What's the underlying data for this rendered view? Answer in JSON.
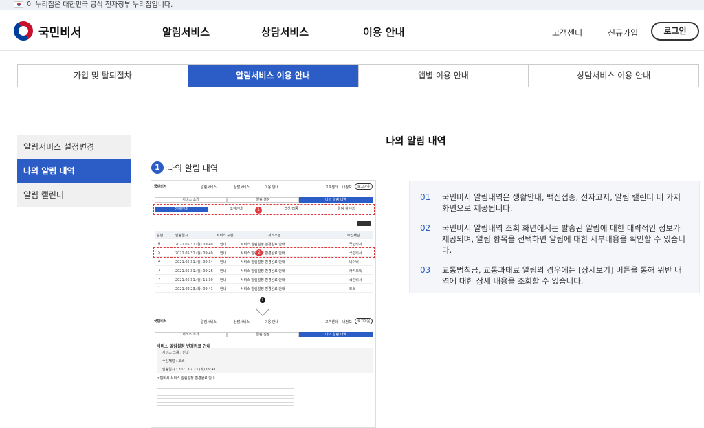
{
  "gov_banner": "이 누리집은 대한민국 공식 전자정부 누리집입니다.",
  "logo": "국민비서",
  "gnb": [
    "알림서비스",
    "상담서비스",
    "이용 안내"
  ],
  "util": {
    "help": "고객센터",
    "signup": "신규가입",
    "login": "로그인"
  },
  "tabs": [
    "가입 및 탈퇴절차",
    "알림서비스 이용 안내",
    "앱별 이용 안내",
    "상담서비스 이용 안내"
  ],
  "side": [
    "알림서비스 설정변경",
    "나의 알림 내역",
    "알림 캘린더"
  ],
  "page_title": "나의 알림 내역",
  "step": {
    "num": "1",
    "label": "나의 알림 내역"
  },
  "shot": {
    "logo": "국민비서",
    "gnb": [
      "알림서비스",
      "상담서비스",
      "이용 안내"
    ],
    "util": [
      "고객센터",
      "내정보",
      "로그아웃"
    ],
    "tabs": [
      "서비스 소개",
      "알림 설정",
      "나의 알림 내역"
    ],
    "subtabs": [
      "생활안내",
      "소식안내",
      "백신/접종",
      "알림 캘린더"
    ],
    "cols": [
      "순번",
      "발송일시",
      "서비스 구분",
      "서비스명",
      "수신채널"
    ],
    "rows": [
      [
        "6",
        "2021.05.31.(월) 09:40",
        "안내",
        "서비스 알림설정 변경완료 안내",
        "국민비서"
      ],
      [
        "5",
        "2021.05.31.(월) 09:40",
        "안내",
        "서비스 알림설정 변경완료 안내",
        "국민비서"
      ],
      [
        "4",
        "2021.05.31.(월) 09:34",
        "안내",
        "서비스 알림설정 변경완료 안내",
        "네이버"
      ],
      [
        "3",
        "2021.05.31.(월) 09:26",
        "안내",
        "서비스 알림설정 변경완료 안내",
        "카카오톡"
      ],
      [
        "2",
        "2021.05.31.(월) 11:30",
        "안내",
        "서비스 알림설정 변경완료 안내",
        "국민비서"
      ],
      [
        "1",
        "2021.02.23.(화) 09:41",
        "안내",
        "서비스 알림설정 변경완료 안내",
        "토스"
      ]
    ],
    "badge1": "1",
    "badge2": "2",
    "badge3": "3",
    "detail_title": "서비스 알림설정 변경완료 안내",
    "detail_lines": [
      "서비스 그룹 : 안내",
      "수신채널 : 토스",
      "발송일시 : 2021.02.23.(화) 09:41"
    ],
    "detail_footer": "국민비서 서비스 알림설정 변경완료 안내"
  },
  "info": [
    {
      "n": "01",
      "t": "국민비서 알림내역은 생활안내, 백신접종, 전자고지, 알림 캘린더 네 가지 화면으로 제공됩니다."
    },
    {
      "n": "02",
      "t": "국민비서 알림내역 조회 화면에서는 발송된 알림에 대한 대략적인 정보가 제공되며, 알림 항목을 선택하면 알림에 대한 세부내용을 확인할 수 있습니다."
    },
    {
      "n": "03",
      "t": "교통범칙금, 교통과태료 알림의 경우에는 [상세보기] 버튼을 통해 위반 내역에 대한 상세 내용을 조회할 수 있습니다."
    }
  ]
}
